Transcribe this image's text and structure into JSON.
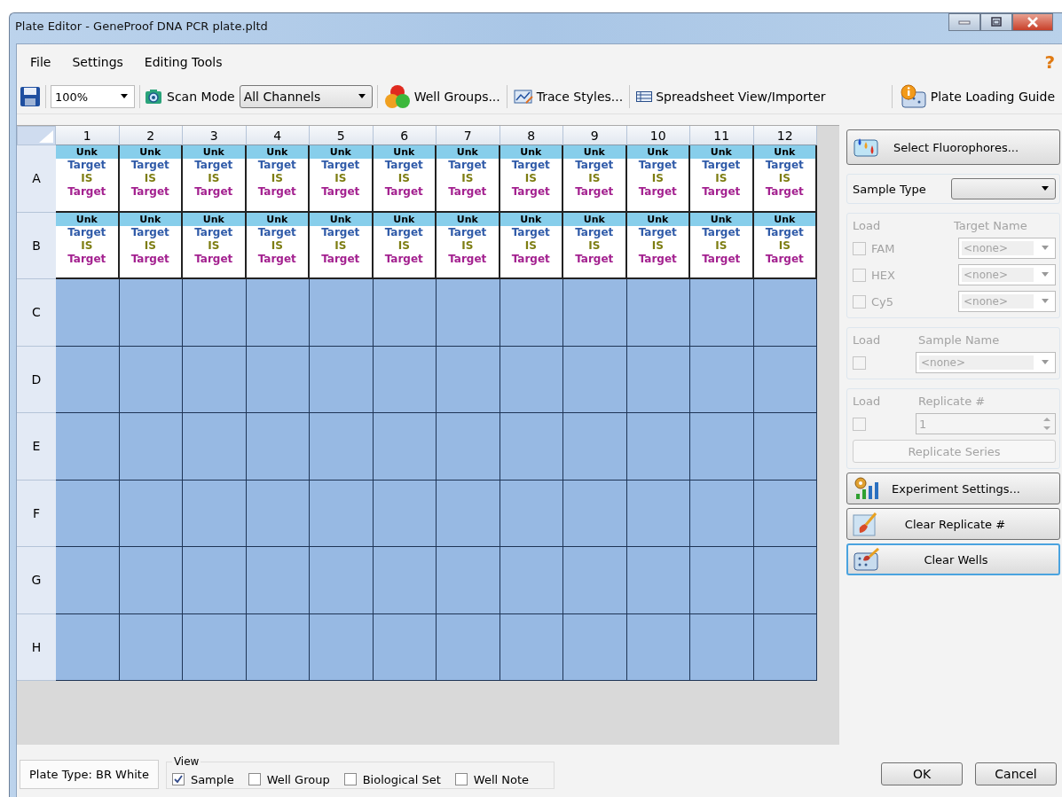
{
  "window": {
    "title": "Plate Editor - GeneProof DNA PCR plate.pltd"
  },
  "menu": [
    "File",
    "Settings",
    "Editing Tools"
  ],
  "help": "?",
  "toolbar": {
    "zoom": "100%",
    "scan_mode_label": "Scan Mode",
    "scan_mode": "All Channels",
    "items": [
      {
        "kind": "groups",
        "label": "Well Groups..."
      },
      {
        "kind": "traces",
        "label": "Trace Styles..."
      },
      {
        "kind": "spreadsheet",
        "label": "Spreadsheet View/Importer"
      }
    ],
    "guide": "Plate Loading Guide"
  },
  "plate": {
    "columns": [
      "1",
      "2",
      "3",
      "4",
      "5",
      "6",
      "7",
      "8",
      "9",
      "10",
      "11",
      "12"
    ],
    "rows": [
      {
        "label": "A",
        "wells": [
          {
            "type": "Unk",
            "lines": [
              {
                "text": "Target",
                "color": "#2f5aa8"
              },
              {
                "text": "IS",
                "color": "#7d7d12"
              },
              {
                "text": "Target",
                "color": "#a3208f"
              }
            ]
          },
          {
            "type": "Unk",
            "lines": [
              {
                "text": "Target",
                "color": "#2f5aa8"
              },
              {
                "text": "IS",
                "color": "#7d7d12"
              },
              {
                "text": "Target",
                "color": "#a3208f"
              }
            ]
          },
          {
            "type": "Unk",
            "lines": [
              {
                "text": "Target",
                "color": "#2f5aa8"
              },
              {
                "text": "IS",
                "color": "#7d7d12"
              },
              {
                "text": "Target",
                "color": "#a3208f"
              }
            ]
          },
          {
            "type": "Unk",
            "lines": [
              {
                "text": "Target",
                "color": "#2f5aa8"
              },
              {
                "text": "IS",
                "color": "#7d7d12"
              },
              {
                "text": "Target",
                "color": "#a3208f"
              }
            ]
          },
          {
            "type": "Unk",
            "lines": [
              {
                "text": "Target",
                "color": "#2f5aa8"
              },
              {
                "text": "IS",
                "color": "#7d7d12"
              },
              {
                "text": "Target",
                "color": "#a3208f"
              }
            ]
          },
          {
            "type": "Unk",
            "lines": [
              {
                "text": "Target",
                "color": "#2f5aa8"
              },
              {
                "text": "IS",
                "color": "#7d7d12"
              },
              {
                "text": "Target",
                "color": "#a3208f"
              }
            ]
          },
          {
            "type": "Unk",
            "lines": [
              {
                "text": "Target",
                "color": "#2f5aa8"
              },
              {
                "text": "IS",
                "color": "#7d7d12"
              },
              {
                "text": "Target",
                "color": "#a3208f"
              }
            ]
          },
          {
            "type": "Unk",
            "lines": [
              {
                "text": "Target",
                "color": "#2f5aa8"
              },
              {
                "text": "IS",
                "color": "#7d7d12"
              },
              {
                "text": "Target",
                "color": "#a3208f"
              }
            ]
          },
          {
            "type": "Unk",
            "lines": [
              {
                "text": "Target",
                "color": "#2f5aa8"
              },
              {
                "text": "IS",
                "color": "#7d7d12"
              },
              {
                "text": "Target",
                "color": "#a3208f"
              }
            ]
          },
          {
            "type": "Unk",
            "lines": [
              {
                "text": "Target",
                "color": "#2f5aa8"
              },
              {
                "text": "IS",
                "color": "#7d7d12"
              },
              {
                "text": "Target",
                "color": "#a3208f"
              }
            ]
          },
          {
            "type": "Unk",
            "lines": [
              {
                "text": "Target",
                "color": "#2f5aa8"
              },
              {
                "text": "IS",
                "color": "#7d7d12"
              },
              {
                "text": "Target",
                "color": "#a3208f"
              }
            ]
          },
          {
            "type": "Unk",
            "lines": [
              {
                "text": "Target",
                "color": "#2f5aa8"
              },
              {
                "text": "IS",
                "color": "#7d7d12"
              },
              {
                "text": "Target",
                "color": "#a3208f"
              }
            ]
          }
        ]
      },
      {
        "label": "B",
        "wells": [
          {
            "type": "Unk",
            "lines": [
              {
                "text": "Target",
                "color": "#2f5aa8"
              },
              {
                "text": "IS",
                "color": "#7d7d12"
              },
              {
                "text": "Target",
                "color": "#a3208f"
              }
            ]
          },
          {
            "type": "Unk",
            "lines": [
              {
                "text": "Target",
                "color": "#2f5aa8"
              },
              {
                "text": "IS",
                "color": "#7d7d12"
              },
              {
                "text": "Target",
                "color": "#a3208f"
              }
            ]
          },
          {
            "type": "Unk",
            "lines": [
              {
                "text": "Target",
                "color": "#2f5aa8"
              },
              {
                "text": "IS",
                "color": "#7d7d12"
              },
              {
                "text": "Target",
                "color": "#a3208f"
              }
            ]
          },
          {
            "type": "Unk",
            "lines": [
              {
                "text": "Target",
                "color": "#2f5aa8"
              },
              {
                "text": "IS",
                "color": "#7d7d12"
              },
              {
                "text": "Target",
                "color": "#a3208f"
              }
            ]
          },
          {
            "type": "Unk",
            "lines": [
              {
                "text": "Target",
                "color": "#2f5aa8"
              },
              {
                "text": "IS",
                "color": "#7d7d12"
              },
              {
                "text": "Target",
                "color": "#a3208f"
              }
            ]
          },
          {
            "type": "Unk",
            "lines": [
              {
                "text": "Target",
                "color": "#2f5aa8"
              },
              {
                "text": "IS",
                "color": "#7d7d12"
              },
              {
                "text": "Target",
                "color": "#a3208f"
              }
            ]
          },
          {
            "type": "Unk",
            "lines": [
              {
                "text": "Target",
                "color": "#2f5aa8"
              },
              {
                "text": "IS",
                "color": "#7d7d12"
              },
              {
                "text": "Target",
                "color": "#a3208f"
              }
            ]
          },
          {
            "type": "Unk",
            "lines": [
              {
                "text": "Target",
                "color": "#2f5aa8"
              },
              {
                "text": "IS",
                "color": "#7d7d12"
              },
              {
                "text": "Target",
                "color": "#a3208f"
              }
            ]
          },
          {
            "type": "Unk",
            "lines": [
              {
                "text": "Target",
                "color": "#2f5aa8"
              },
              {
                "text": "IS",
                "color": "#7d7d12"
              },
              {
                "text": "Target",
                "color": "#a3208f"
              }
            ]
          },
          {
            "type": "Unk",
            "lines": [
              {
                "text": "Target",
                "color": "#2f5aa8"
              },
              {
                "text": "IS",
                "color": "#7d7d12"
              },
              {
                "text": "Target",
                "color": "#a3208f"
              }
            ]
          },
          {
            "type": "Unk",
            "lines": [
              {
                "text": "Target",
                "color": "#2f5aa8"
              },
              {
                "text": "IS",
                "color": "#7d7d12"
              },
              {
                "text": "Target",
                "color": "#a3208f"
              }
            ]
          },
          {
            "type": "Unk",
            "lines": [
              {
                "text": "Target",
                "color": "#2f5aa8"
              },
              {
                "text": "IS",
                "color": "#7d7d12"
              },
              {
                "text": "Target",
                "color": "#a3208f"
              }
            ]
          }
        ]
      },
      {
        "label": "C"
      },
      {
        "label": "D"
      },
      {
        "label": "E"
      },
      {
        "label": "F"
      },
      {
        "label": "G"
      },
      {
        "label": "H"
      }
    ]
  },
  "side": {
    "fluorophores_button": "Select Fluorophores...",
    "sample_type": {
      "label": "Sample Type"
    },
    "targets": {
      "disabled": true,
      "load_header": "Load",
      "name_header": "Target Name",
      "rows": [
        {
          "dye": "FAM",
          "checked": false,
          "value": "<none>"
        },
        {
          "dye": "HEX",
          "checked": false,
          "value": "<none>"
        },
        {
          "dye": "Cy5",
          "checked": false,
          "value": "<none>"
        }
      ]
    },
    "sample_name": {
      "disabled": true,
      "load_header": "Load",
      "name_header": "Sample Name",
      "checked": false,
      "value": "<none>"
    },
    "replicate": {
      "disabled": true,
      "load_header": "Load",
      "name_header": "Replicate #",
      "checked": false,
      "value": "1",
      "series_button": "Replicate Series"
    },
    "actions": [
      {
        "kind": "settings",
        "label": "Experiment Settings...",
        "focused": false
      },
      {
        "kind": "replicate",
        "label": "Clear Replicate #",
        "focused": false
      },
      {
        "kind": "wells",
        "label": "Clear Wells",
        "focused": true
      }
    ]
  },
  "footer": {
    "plate_type": "Plate Type: BR White",
    "view": {
      "title": "View",
      "options": [
        {
          "label": "Sample",
          "checked": true
        },
        {
          "label": "Well Group",
          "checked": false
        },
        {
          "label": "Biological Set",
          "checked": false
        },
        {
          "label": "Well Note",
          "checked": false
        }
      ]
    },
    "buttons": [
      "OK",
      "Cancel"
    ]
  }
}
